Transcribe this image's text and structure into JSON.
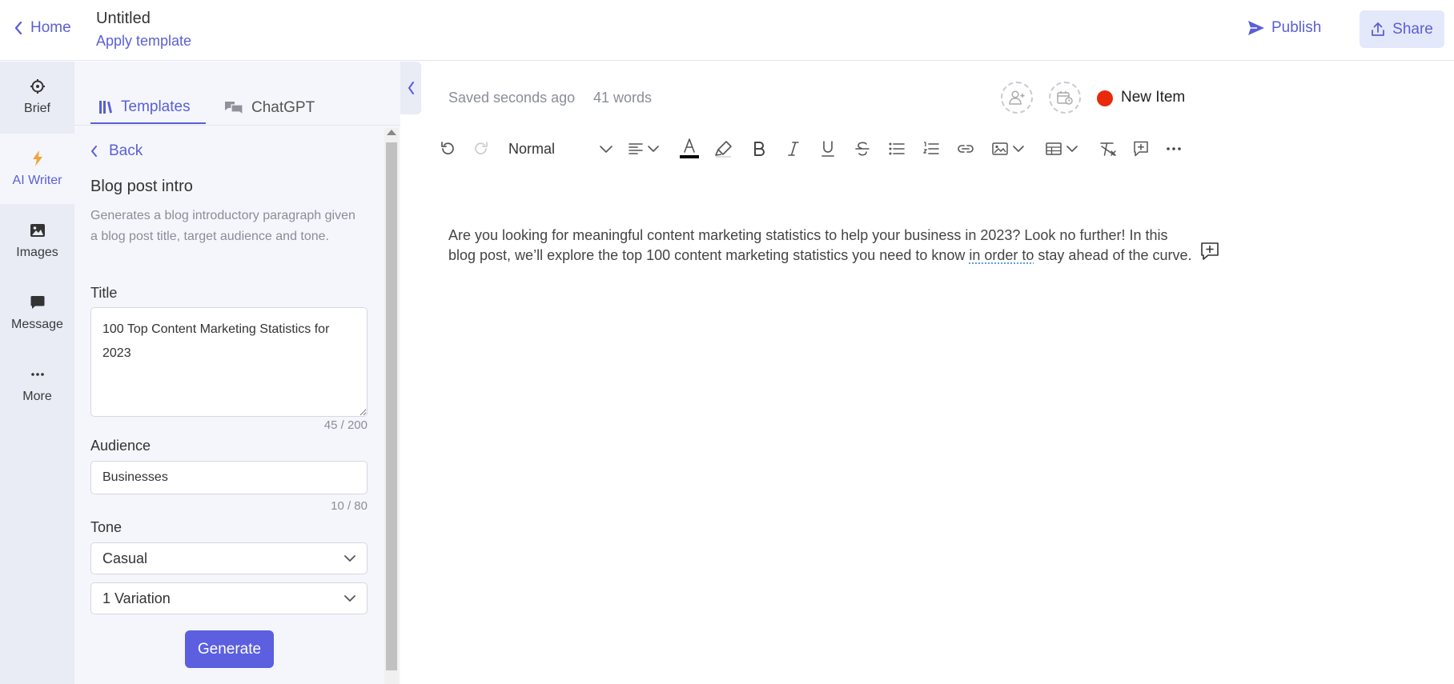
{
  "header": {
    "home_label": "Home",
    "doc_title": "Untitled",
    "apply_template_label": "Apply template",
    "publish_label": "Publish",
    "share_label": "Share"
  },
  "rail": {
    "items": [
      {
        "label": "Brief",
        "icon": "crosshair-icon"
      },
      {
        "label": "AI Writer",
        "icon": "lightning-icon"
      },
      {
        "label": "Images",
        "icon": "image-icon"
      },
      {
        "label": "Message",
        "icon": "chat-bubble-icon"
      },
      {
        "label": "More",
        "icon": "more-dots-icon"
      }
    ],
    "active": "AI Writer"
  },
  "panel": {
    "tabs": [
      {
        "label": "Templates",
        "icon": "books-icon"
      },
      {
        "label": "ChatGPT",
        "icon": "chat-bubbles-icon"
      }
    ],
    "back_label": "Back",
    "template_title": "Blog post intro",
    "template_description": "Generates a blog introductory paragraph given a blog post title, target audience and tone.",
    "title_field": {
      "label": "Title",
      "value": "100 Top Content Marketing Statistics for 2023",
      "counter": "45 / 200"
    },
    "audience_field": {
      "label": "Audience",
      "value": "Businesses",
      "counter": "10 / 80"
    },
    "tone_field": {
      "label": "Tone",
      "value": "Casual"
    },
    "variation_select": {
      "value": "1 Variation"
    },
    "generate_label": "Generate"
  },
  "editor": {
    "saved_status": "Saved seconds ago",
    "word_count": "41 words",
    "status_label": "New Item",
    "status_color": "#e8290b",
    "paragraph_style": "Normal",
    "content_before": "Are you looking for meaningful content marketing statistics to help your business in 2023? Look no further! In this blog post, we’ll explore the top 100 content marketing statistics you need to know ",
    "content_flagged": "in order to",
    "content_after": " stay ahead of the curve."
  },
  "colors": {
    "accent": "#5a5fd6",
    "button": "#5b5fe0",
    "rail_bg": "#e9ebf5",
    "panel_bg": "#f5f6fb"
  }
}
